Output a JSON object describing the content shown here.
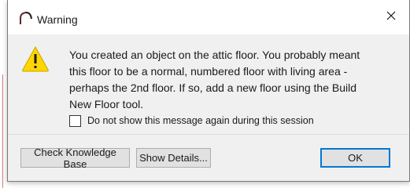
{
  "window": {
    "title": "Warning",
    "close_glyph": "✕"
  },
  "icons": {
    "app": "arc-logo-icon",
    "warning": "warning-triangle-icon",
    "close": "close-icon"
  },
  "message": {
    "lines": [
      "You created an object on the attic floor.  You probably meant",
      "this floor to be  a normal, numbered floor with living area -",
      "perhaps the 2nd floor.  If so, add  a new floor using the Build",
      "New Floor tool."
    ]
  },
  "checkbox": {
    "label": "Do not show this message again during this session",
    "checked": false
  },
  "buttons": {
    "knowledge_base": "Check Knowledge Base",
    "show_details": "Show Details...",
    "ok": "OK"
  },
  "colors": {
    "accent": "#0078d7",
    "warning_fill": "#ffd600",
    "background_line": "#d87a7a"
  }
}
